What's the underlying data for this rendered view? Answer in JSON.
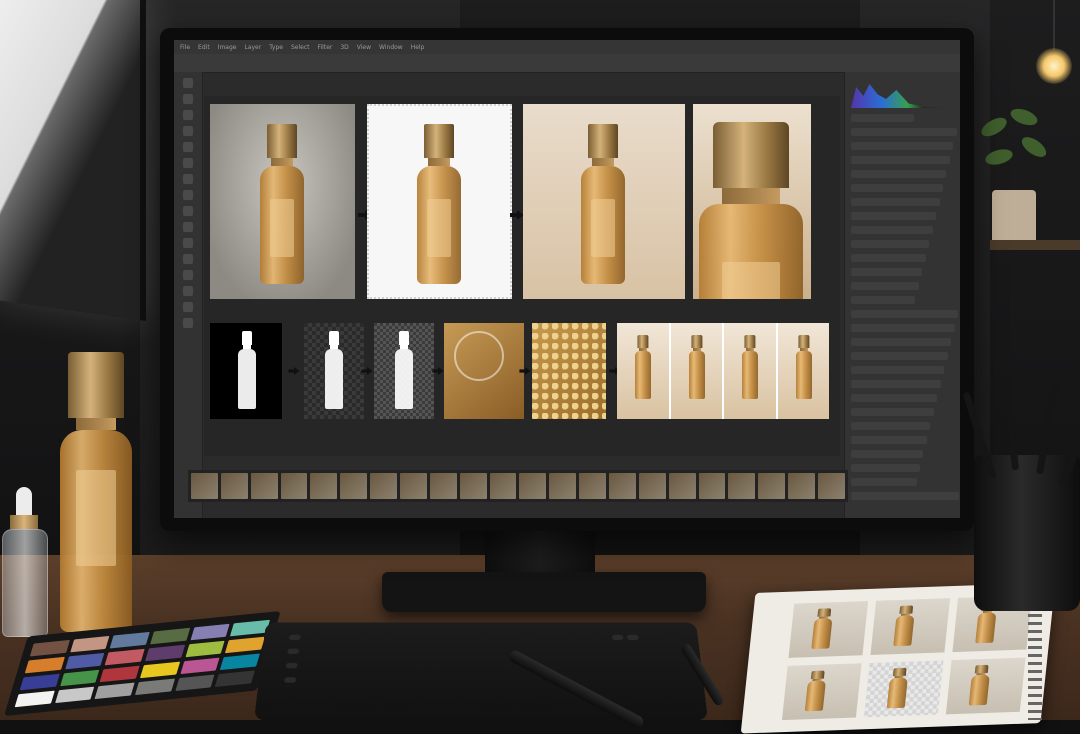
{
  "scene": {
    "description_type": "photo-of-workspace"
  },
  "app": {
    "menu": [
      "File",
      "Edit",
      "Image",
      "Layer",
      "Type",
      "Select",
      "Filter",
      "3D",
      "View",
      "Window",
      "Help"
    ],
    "tool_count": 16,
    "filmstrip_count": 22
  },
  "colors": {
    "gold": "#c48c3f",
    "cap_gold": "#d4b27a",
    "desk_wood": "#4a3222",
    "screen_bg": "#2b2b2c"
  },
  "colorchecker": [
    "#735244",
    "#c29682",
    "#627a9d",
    "#576c43",
    "#8580b1",
    "#67bdaa",
    "#d67e2c",
    "#505ba6",
    "#c15a63",
    "#5e3c6c",
    "#9dbc40",
    "#e0a32e",
    "#383d96",
    "#469449",
    "#af363c",
    "#e7c71f",
    "#bb5695",
    "#0885a1",
    "#f3f3f2",
    "#c8c8c8",
    "#a0a0a0",
    "#7a7a79",
    "#555555",
    "#343434"
  ]
}
